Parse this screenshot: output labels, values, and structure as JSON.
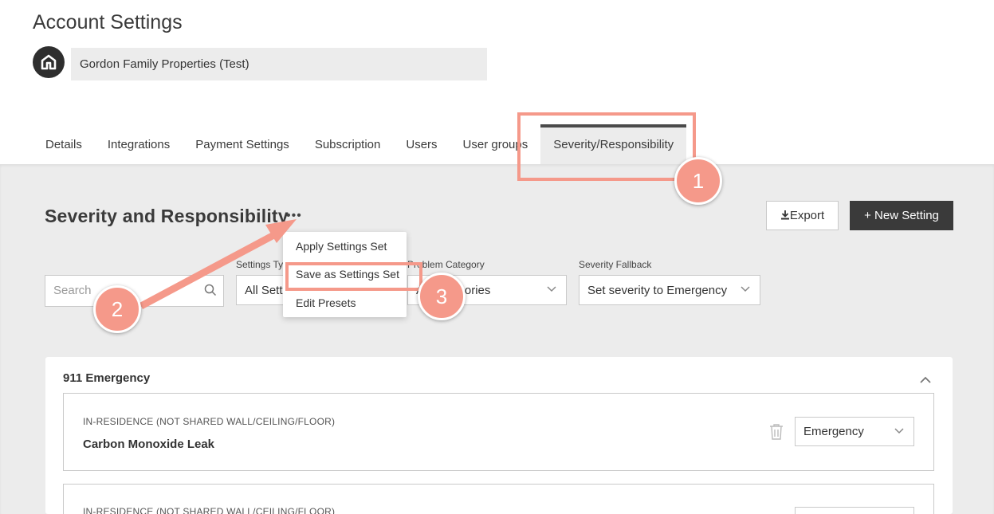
{
  "page": {
    "title": "Account Settings"
  },
  "account": {
    "name": "Gordon Family Properties (Test)",
    "icon": "home-icon"
  },
  "tabs": [
    {
      "label": "Details"
    },
    {
      "label": "Integrations"
    },
    {
      "label": "Payment Settings"
    },
    {
      "label": "Subscription"
    },
    {
      "label": "Users"
    },
    {
      "label": "User groups"
    },
    {
      "label": "Severity/Responsibility",
      "active": true
    }
  ],
  "section": {
    "title": "Severity and Responsibility",
    "more_label": "•••"
  },
  "actions": {
    "export_label": "Export",
    "new_label": "+ New Setting"
  },
  "filters": {
    "search_placeholder": "Search",
    "settings_type_label": "Settings Type",
    "settings_type_value": "All Settings",
    "problem_category_label": "Problem Category",
    "problem_category_value": "All Categories",
    "severity_fallback_label": "Severity Fallback",
    "severity_fallback_value": "Set severity to Emergency"
  },
  "menu": {
    "items": [
      {
        "label": "Apply Settings Set"
      },
      {
        "label": "Save as Settings Set"
      },
      {
        "label": "Edit Presets"
      }
    ]
  },
  "group": {
    "title": "911 Emergency",
    "items": [
      {
        "location": "IN-RESIDENCE (NOT SHARED WALL/CEILING/FLOOR)",
        "name": "Carbon Monoxide Leak",
        "severity": "Emergency"
      },
      {
        "location": "IN-RESIDENCE (NOT SHARED WALL/CEILING/FLOOR)",
        "name": "",
        "severity": ""
      }
    ]
  },
  "annotations": {
    "step1": "1",
    "step2": "2",
    "step3": "3",
    "color": "#f5998a"
  }
}
